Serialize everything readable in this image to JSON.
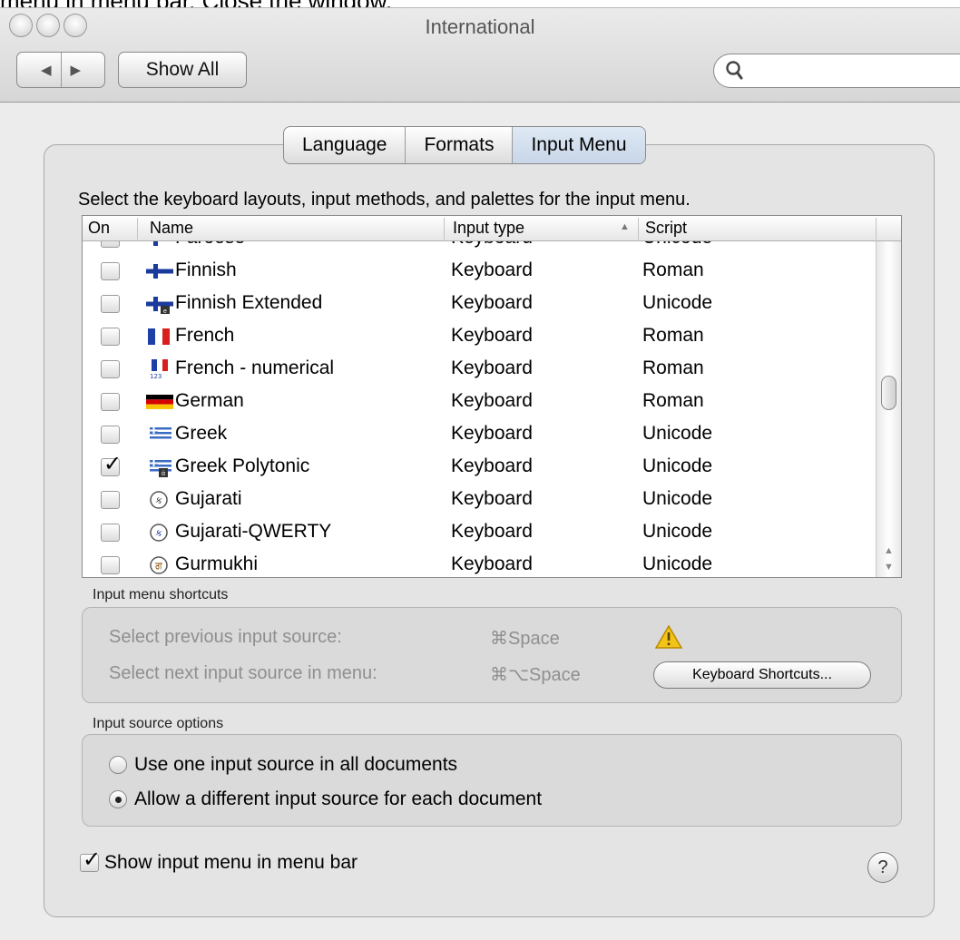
{
  "caption": "menu in menu bar. Close the window.",
  "window": {
    "title": "International"
  },
  "toolbar": {
    "back_icon": "◀",
    "forward_icon": "▶",
    "show_all_label": "Show All",
    "search_placeholder": "",
    "search_icon": "🔍"
  },
  "tabs": [
    {
      "label": "Language",
      "active": false
    },
    {
      "label": "Formats",
      "active": false
    },
    {
      "label": "Input Menu",
      "active": true
    }
  ],
  "instructions": "Select the keyboard layouts, input methods, and palettes for the input menu.",
  "table": {
    "columns": {
      "on": "On",
      "name": "Name",
      "type": "Input type",
      "script": "Script"
    },
    "sort_indicator": "▲",
    "rows": [
      {
        "checked": false,
        "flag": "faroese-flag-icon",
        "name": "Faroese",
        "type": "Keyboard",
        "script": "Unicode"
      },
      {
        "checked": false,
        "flag": "finnish-flag-icon",
        "name": "Finnish",
        "type": "Keyboard",
        "script": "Roman"
      },
      {
        "checked": false,
        "flag": "finnish-extended-flag-icon",
        "name": "Finnish Extended",
        "type": "Keyboard",
        "script": "Unicode"
      },
      {
        "checked": false,
        "flag": "french-flag-icon",
        "name": "French",
        "type": "Keyboard",
        "script": "Roman"
      },
      {
        "checked": false,
        "flag": "french-numerical-flag-icon",
        "name": "French - numerical",
        "type": "Keyboard",
        "script": "Roman"
      },
      {
        "checked": false,
        "flag": "german-flag-icon",
        "name": "German",
        "type": "Keyboard",
        "script": "Roman"
      },
      {
        "checked": false,
        "flag": "greek-flag-icon",
        "name": "Greek",
        "type": "Keyboard",
        "script": "Unicode"
      },
      {
        "checked": true,
        "flag": "greek-polytonic-flag-icon",
        "name": "Greek Polytonic",
        "type": "Keyboard",
        "script": "Unicode"
      },
      {
        "checked": false,
        "flag": "gujarati-icon",
        "name": "Gujarati",
        "type": "Keyboard",
        "script": "Unicode"
      },
      {
        "checked": false,
        "flag": "gujarati-qwerty-icon",
        "name": "Gujarati-QWERTY",
        "type": "Keyboard",
        "script": "Unicode"
      },
      {
        "checked": false,
        "flag": "gurmukhi-icon",
        "name": "Gurmukhi",
        "type": "Keyboard",
        "script": "Unicode"
      }
    ]
  },
  "shortcuts": {
    "group_label": "Input menu shortcuts",
    "previous_label": "Select previous input source:",
    "previous_key": "⌘Space",
    "next_label": "Select next input source in menu:",
    "next_key": "⌘⌥Space",
    "keyboard_shortcuts_button": "Keyboard Shortcuts..."
  },
  "options": {
    "group_label": "Input source options",
    "one_source_label": "Use one input source in all documents",
    "different_source_label": "Allow a different input source for each document",
    "selected": "different"
  },
  "show_menu": {
    "label": "Show input menu in menu bar",
    "checked": true
  },
  "help": {
    "label": "?"
  }
}
